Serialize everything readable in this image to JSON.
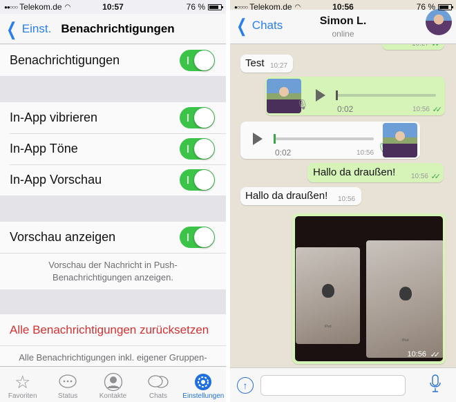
{
  "left": {
    "status": {
      "carrier": "Telekom.de",
      "signal": "●●○○○",
      "time": "10:57",
      "battery": "76 %"
    },
    "nav": {
      "back": "Einst.",
      "title": "Benachrichtigungen"
    },
    "rows": {
      "notifications": {
        "label": "Benachrichtigungen",
        "on": true
      },
      "vibrate": {
        "label": "In-App vibrieren",
        "on": true
      },
      "sounds": {
        "label": "In-App Töne",
        "on": true
      },
      "preview_inapp": {
        "label": "In-App Vorschau",
        "on": true
      },
      "show_preview": {
        "label": "Vorschau anzeigen",
        "on": true
      }
    },
    "preview_note": "Vorschau der Nachricht in Push-Benachrichtigungen anzeigen.",
    "reset_label": "Alle Benachrichtigungen zurücksetzen",
    "reset_note": "Alle Benachrichtigungen inkl. eigener Gruppen-Benachrichtigungen zurücksetzen.",
    "tabs": [
      "Favoriten",
      "Status",
      "Kontakte",
      "Chats",
      "Einstellungen"
    ],
    "active_tab": "Einstellungen"
  },
  "right": {
    "status": {
      "carrier": "Telekom.de",
      "signal": "●○○○○",
      "time": "10:56",
      "battery": "76 %"
    },
    "nav": {
      "back": "Chats",
      "name": "Simon L.",
      "presence": "online"
    },
    "messages": [
      {
        "dir": "out",
        "type": "text",
        "text": "",
        "time": "10:27",
        "read": "✓✓"
      },
      {
        "dir": "in",
        "type": "text",
        "text": "Test",
        "time": "10:27"
      },
      {
        "dir": "out",
        "type": "voice",
        "duration": "0:02",
        "time": "10:56",
        "read": "✓✓"
      },
      {
        "dir": "in",
        "type": "voice",
        "duration": "0:02",
        "time": "10:56"
      },
      {
        "dir": "out",
        "type": "text",
        "text": "Hallo da draußen!",
        "time": "10:56",
        "read": "✓✓"
      },
      {
        "dir": "in",
        "type": "text",
        "text": "Hallo da draußen!",
        "time": "10:56"
      },
      {
        "dir": "out",
        "type": "image",
        "time": "10:56",
        "read": "✓✓",
        "caption_text": [
          "iPad",
          "iPad"
        ]
      }
    ]
  }
}
